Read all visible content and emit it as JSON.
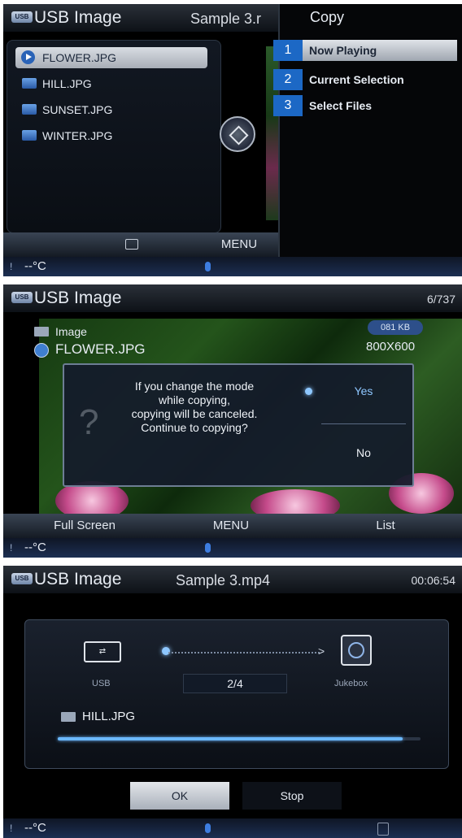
{
  "screen1": {
    "title": "USB Image",
    "track": "Sample 3.r",
    "files": [
      "FLOWER.JPG",
      "HILL.JPG",
      "SUNSET.JPG",
      "WINTER.JPG"
    ],
    "selected_file": "FLOWER.JPG",
    "softkeys": [
      "",
      "MENU"
    ],
    "copy_popup": {
      "title": "Copy",
      "options": [
        {
          "num": "1",
          "label": "Now Playing",
          "selected": true
        },
        {
          "num": "2",
          "label": "Current Selection",
          "selected": false
        },
        {
          "num": "3",
          "label": "Select Files",
          "selected": false
        }
      ]
    },
    "status": {
      "temp": "--°C",
      "icon": "!"
    }
  },
  "screen2": {
    "title": "USB Image",
    "counter": "6/737",
    "folder": "Image",
    "file": "FLOWER.JPG",
    "size": "081 KB",
    "resolution": "800X600",
    "dialog": {
      "message_lines": [
        "If you change the mode",
        "while copying,",
        "copying will be canceled.",
        "Continue to copying?"
      ],
      "yes": "Yes",
      "no": "No"
    },
    "softkeys": {
      "left": "Full Screen",
      "mid": "MENU",
      "right": "List"
    },
    "status": {
      "temp": "--°C",
      "icon": "!"
    }
  },
  "screen3": {
    "title": "USB Image",
    "track": "Sample 3.mp4",
    "time": "00:06:54",
    "source": "USB",
    "target": "Jukebox",
    "count": "2/4",
    "file": "HILL.JPG",
    "progress": 0.95,
    "buttons": {
      "ok": "OK",
      "stop": "Stop"
    },
    "status": {
      "temp": "--°C",
      "icon": "!"
    }
  }
}
